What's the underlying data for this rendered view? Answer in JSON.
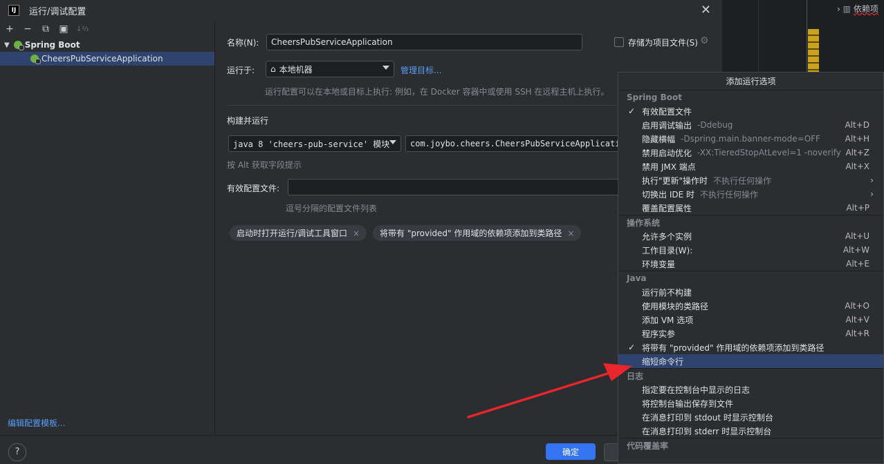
{
  "window": {
    "title": "运行/调试配置",
    "icon_text": "IJ"
  },
  "toolbar": {
    "add": "+",
    "remove": "−",
    "copy": "⧉",
    "folder": "▣",
    "sort": "↓⅔"
  },
  "tree": {
    "group": "Spring Boot",
    "item": "CheersPubServiceApplication"
  },
  "edit_templates": "编辑配置模板...",
  "form": {
    "name_label": "名称(N):",
    "name_value": "CheersPubServiceApplication",
    "store_label": "存储为项目文件(S)",
    "run_on_label": "运行于:",
    "run_on_value": "本地机器",
    "manage_targets": "管理目标...",
    "run_on_hint": "运行配置可以在本地或目标上执行: 例如，在 Docker 容器中或使用 SSH 在远程主机上执行。",
    "build_run_label": "构建并运行",
    "jdk_value": "java 8 'cheers-pub-service' 模块",
    "main_class": "com.joybo.cheers.CheersPubServiceApplicatio",
    "alt_hint": "按 Alt 获取字段提示",
    "profiles_label": "有效配置文件:",
    "profiles_hint": "逗号分隔的配置文件列表",
    "chips": [
      "启动时打开运行/调试工具窗口",
      "将带有 \"provided\" 作用域的依赖项添加到类路径"
    ]
  },
  "buttons": {
    "ok": "确定",
    "help": "?"
  },
  "ide": {
    "tree_text": "依赖项"
  },
  "popup": {
    "title": "添加运行选项",
    "sections": {
      "spring": "Spring Boot",
      "os": "操作系统",
      "java": "Java",
      "log": "日志",
      "coverage": "代码覆盖率"
    },
    "spring_items": [
      {
        "label": "有效配置文件",
        "sub": "",
        "shortcut": "",
        "checked": "✓"
      },
      {
        "label": "启用调试输出",
        "sub": "-Ddebug",
        "shortcut": "Alt+D",
        "checked": ""
      },
      {
        "label": "隐藏横幅",
        "sub": "-Dspring.main.banner-mode=OFF",
        "shortcut": "Alt+H",
        "checked": ""
      },
      {
        "label": "禁用启动优化",
        "sub": "-XX:TieredStopAtLevel=1 -noverify",
        "shortcut": "Alt+Z",
        "checked": ""
      },
      {
        "label": "禁用 JMX 端点",
        "sub": "",
        "shortcut": "Alt+X",
        "checked": ""
      },
      {
        "label": "执行\"更新\"操作时",
        "sub": "不执行任何操作",
        "shortcut": "",
        "checked": ""
      },
      {
        "label": "切换出 IDE 时",
        "sub": "不执行任何操作",
        "shortcut": "",
        "checked": ""
      },
      {
        "label": "覆盖配置属性",
        "sub": "",
        "shortcut": "Alt+P",
        "checked": ""
      }
    ],
    "os_items": [
      {
        "label": "允许多个实例",
        "shortcut": "Alt+U"
      },
      {
        "label": "工作目录(W):",
        "shortcut": "Alt+W"
      },
      {
        "label": "环境变量",
        "shortcut": "Alt+E"
      }
    ],
    "java_items": [
      {
        "label": "运行前不构建",
        "shortcut": ""
      },
      {
        "label": "使用模块的类路径",
        "shortcut": "Alt+O"
      },
      {
        "label": "添加 VM 选项",
        "shortcut": "Alt+V"
      },
      {
        "label": "程序实参",
        "shortcut": "Alt+R"
      },
      {
        "label": "将带有 \"provided\" 作用域的依赖项添加到类路径",
        "shortcut": "",
        "checked": "✓"
      },
      {
        "label": "缩短命令行",
        "shortcut": ""
      }
    ],
    "log_items": [
      {
        "label": "指定要在控制台中显示的日志"
      },
      {
        "label": "将控制台输出保存到文件"
      },
      {
        "label": "在消息打印到 stdout 时显示控制台"
      },
      {
        "label": "在消息打印到 stderr 时显示控制台"
      }
    ]
  },
  "annotation_color": "#e8262b"
}
